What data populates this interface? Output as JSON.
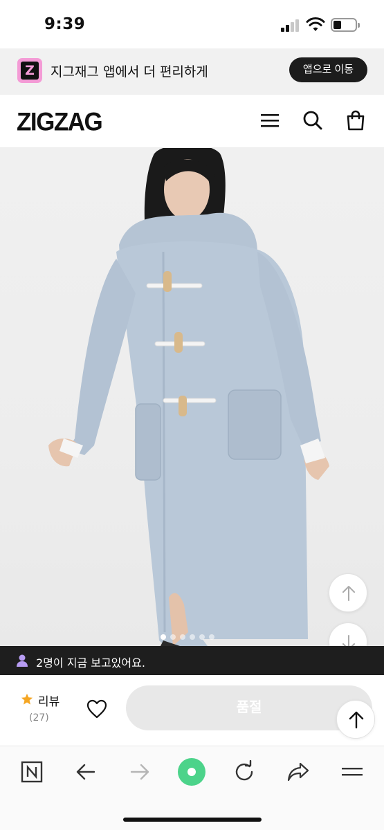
{
  "status_bar": {
    "time": "9:39"
  },
  "app_banner": {
    "logo_letter": "Z",
    "message": "지그재그 앱에서 더 편리하게",
    "button_label": "앱으로 이동"
  },
  "header": {
    "logo_text": "ZIGZAG",
    "icons": [
      "menu-icon",
      "search-icon",
      "shopping-bag-icon"
    ]
  },
  "product": {
    "image_alt_icon": "product-photo",
    "carousel": {
      "total": 7,
      "active_index": 0
    }
  },
  "viewers": {
    "text": "2명이 지금 보고있어요."
  },
  "purchase_bar": {
    "review_label": "리뷰",
    "review_count": "(27)",
    "soldout_label": "품절"
  },
  "colors": {
    "banner_logo": "#f49bd6",
    "coat": "#b9c8d8",
    "star": "#f5a623",
    "play_button": "#4cd38a",
    "viewer_icon": "#b79cf2"
  }
}
